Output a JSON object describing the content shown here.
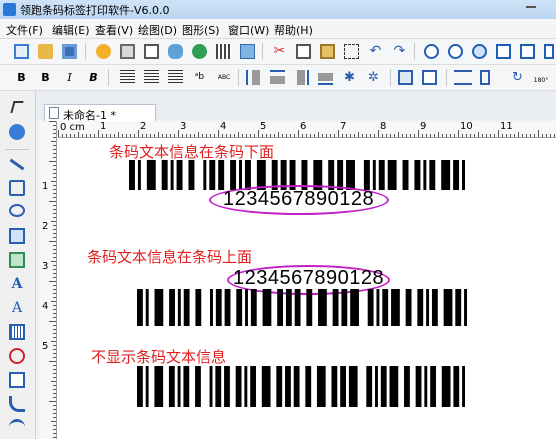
{
  "app": {
    "title": "领跑条码标签打印软件-V6.0.0"
  },
  "menu": [
    "文件(F)",
    "编辑(E)",
    "查看(V)",
    "绘图(D)",
    "图形(S)",
    "窗口(W)",
    "帮助(H)"
  ],
  "format_toolbar": {
    "bold": "B",
    "bold2": "B",
    "italic": "I",
    "bolditalic": "B",
    "abc": "ABC",
    "font_size": "180°"
  },
  "document": {
    "tab_label": "未命名-1 *"
  },
  "ruler": {
    "unit_label": "0 cm",
    "h_numbers": [
      "1",
      "2",
      "3",
      "4",
      "5",
      "6",
      "7",
      "8",
      "9",
      "10",
      "11"
    ],
    "v_numbers": [
      "1",
      "2",
      "3",
      "4",
      "5"
    ]
  },
  "barcodes": [
    {
      "caption": "条码文本信息在条码下面",
      "text": "1234567890128",
      "text_position": "below",
      "highlight_color": "#c21fc6"
    },
    {
      "caption": "条码文本信息在条码上面",
      "text": "1234567890128",
      "text_position": "above",
      "highlight_color": "#c21fc6"
    },
    {
      "caption": "不显示条码文本信息",
      "text": "",
      "text_position": "none"
    }
  ],
  "barcode_pattern": "11010011100110101100110001011011001101011001110011011011001100111001101101110001101011011100110011010110011101101"
}
